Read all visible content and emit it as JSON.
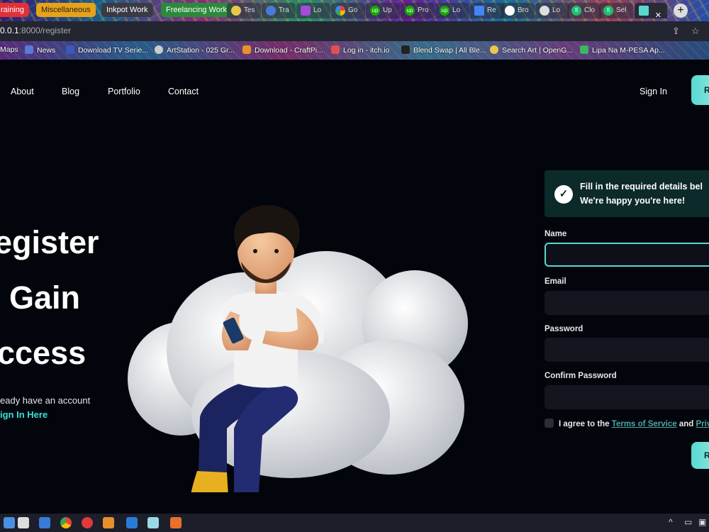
{
  "browser": {
    "tab_groups": [
      {
        "label": "raining",
        "color": "#e0303a"
      },
      {
        "label": "Miscellaneous",
        "color": "#e8a21a"
      },
      {
        "label": "Inkpot Work",
        "color": "#3a3a45"
      },
      {
        "label": "Freelancing Work",
        "color": "#2a8a3a"
      }
    ],
    "tabs": [
      {
        "label": "Tes",
        "icon": "cloud-icon"
      },
      {
        "label": "Tra",
        "icon": "globe-icon"
      },
      {
        "label": "Lo",
        "icon": "page-icon"
      },
      {
        "label": "Go",
        "icon": "google-icon"
      },
      {
        "label": "Up",
        "icon": "upwork-icon"
      },
      {
        "label": "Pro",
        "icon": "upwork-icon"
      },
      {
        "label": "Lo",
        "icon": "upwork-icon"
      },
      {
        "label": "Re",
        "icon": "docs-icon"
      },
      {
        "label": "Bro",
        "icon": "github-icon"
      },
      {
        "label": "Lo",
        "icon": "globe-icon"
      },
      {
        "label": "Clo",
        "icon": "fiverr-icon"
      },
      {
        "label": "Sel",
        "icon": "fiverr-icon"
      }
    ],
    "tab_close": "✕",
    "new_tab": "+",
    "url_prefix": "0.0.1",
    "url_rest": ":8000/register",
    "bookmarks": [
      {
        "label": "Maps",
        "color": "#4a90e2"
      },
      {
        "label": "News",
        "color": "#5a7ad8"
      },
      {
        "label": "Download TV Serie...",
        "color": "#3a5ab8"
      },
      {
        "label": "ArtStation - 025 Gr...",
        "color": "#cccccc"
      },
      {
        "label": "Download - CraftPi...",
        "color": "#e8902a"
      },
      {
        "label": "Log in - itch.io",
        "color": "#e05050"
      },
      {
        "label": "Blend Swap | All Ble...",
        "color": "#222222"
      },
      {
        "label": "Search Art | OpenG...",
        "color": "#e8c84a"
      },
      {
        "label": "Lipa Na M-PESA Ap...",
        "color": "#3ab85a"
      }
    ]
  },
  "nav": {
    "about": "About",
    "blog": "Blog",
    "portfolio": "Portfolio",
    "contact": "Contact",
    "signin": "Sign In",
    "register_cta": "R"
  },
  "hero": {
    "line1": "egister",
    "line2": "Gain",
    "line3": "ccess",
    "sub": "eady have an account",
    "link": "ign In Here"
  },
  "form": {
    "notice_line1": "Fill in the required details bel",
    "notice_line2": "We're happy you're here!",
    "name_label": "Name",
    "email_label": "Email",
    "password_label": "Password",
    "confirm_label": "Confirm Password",
    "agree_text": "I agree to the",
    "terms": "Terms of Service",
    "and": "and",
    "privacy": "Priv",
    "submit": "R"
  },
  "colors": {
    "accent": "#5ad8d0",
    "background": "#03050c"
  }
}
